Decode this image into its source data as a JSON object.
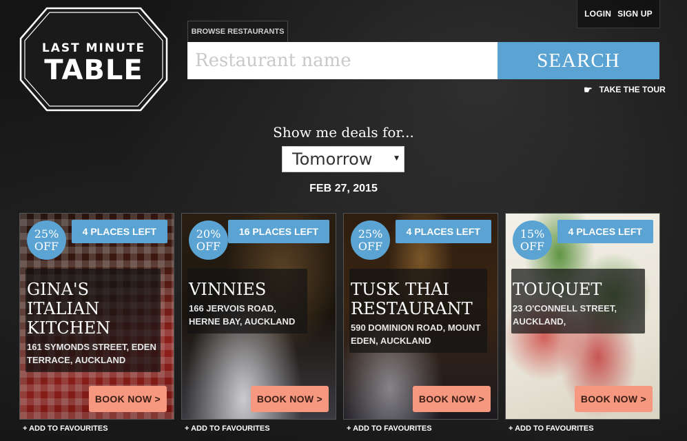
{
  "logo": {
    "line1": "LAST MINUTE",
    "line2": "TABLE"
  },
  "auth": {
    "login": "LOGIN",
    "signup": "SIGN UP"
  },
  "search": {
    "tab_label": "BROWSE RESTAURANTS",
    "placeholder": "Restaurant name",
    "button_label": "SEARCH",
    "tour_label": "TAKE THE TOUR",
    "accent": "#5aa3d2"
  },
  "deals": {
    "prompt": "Show me deals for...",
    "selected_day": "Tomorrow",
    "date": "FEB 27, 2015"
  },
  "restaurants": [
    {
      "discount_pct": "25%",
      "discount_label": "OFF",
      "places": "4 PLACES LEFT",
      "name": "GINA'S ITALIAN KITCHEN",
      "address": "161 SYMONDS STREET, EDEN TERRACE, AUCKLAND",
      "book": "BOOK NOW >",
      "favourite": "+ ADD TO FAVOURITES"
    },
    {
      "discount_pct": "20%",
      "discount_label": "OFF",
      "places": "16 PLACES LEFT",
      "name": "VINNIES",
      "address": "166 JERVOIS ROAD, HERNE BAY, AUCKLAND",
      "book": "BOOK NOW >",
      "favourite": "+ ADD TO FAVOURITES"
    },
    {
      "discount_pct": "25%",
      "discount_label": "OFF",
      "places": "4 PLACES LEFT",
      "name": "TUSK THAI RESTAURANT",
      "address": "590 DOMINION ROAD, MOUNT EDEN, AUCKLAND",
      "book": "BOOK NOW >",
      "favourite": "+ ADD TO FAVOURITES"
    },
    {
      "discount_pct": "15%",
      "discount_label": "OFF",
      "places": "4 PLACES LEFT",
      "name": "TOUQUET",
      "address": "23 O'CONNELL STREET, AUCKLAND,",
      "book": "BOOK NOW >",
      "favourite": "+ ADD TO FAVOURITES"
    }
  ],
  "colors": {
    "book_button": "#f6977f",
    "badge": "#5aa3d2"
  }
}
